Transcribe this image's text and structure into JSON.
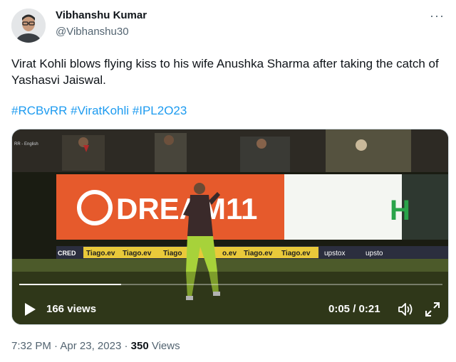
{
  "author": {
    "name": "Vibhanshu Kumar",
    "handle": "@Vibhanshu30"
  },
  "tweet": {
    "text": "Virat Kohli blows flying kiss to his wife Anushka Sharma after taking the catch of Yashasvi Jaiswal.",
    "hashtags": [
      "#RCBvRR",
      "#ViratKohli",
      "#IPL2O23"
    ],
    "more_icon": "more-horizontal-icon"
  },
  "video": {
    "views": "166 views",
    "time": "0:05 / 0:21",
    "progress": 0.24,
    "broadcast_tag": "RR - English",
    "boards": {
      "main": "DREAM11",
      "sponsor_strip": [
        "CRED",
        "Tiago.ev",
        "Tiago.ev",
        "Tiago",
        "o.ev",
        "Tiago.ev",
        "Tiago.ev",
        "upstox",
        "upsto"
      ]
    },
    "icons": [
      "play-icon",
      "volume-icon",
      "fullscreen-icon"
    ]
  },
  "meta": {
    "time": "7:32 PM",
    "date": "Apr 23, 2023",
    "separator": "·",
    "views_count": "350",
    "views_label": "Views"
  }
}
